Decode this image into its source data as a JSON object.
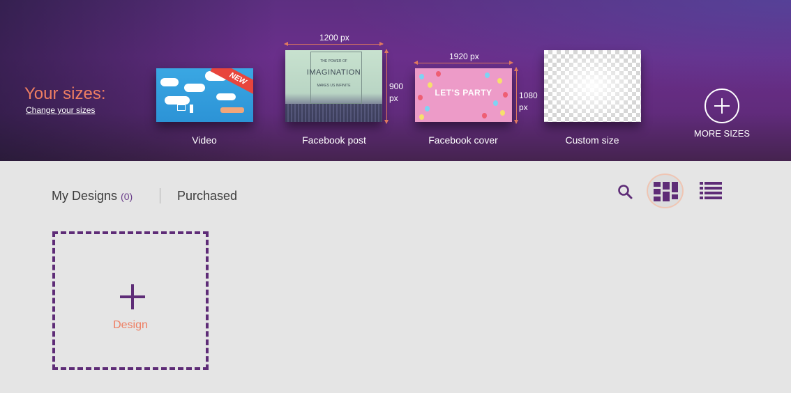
{
  "sizes_panel": {
    "heading": "Your sizes:",
    "change_link": "Change your sizes",
    "cards": [
      {
        "label": "Video",
        "thumb_badge": "NEW"
      },
      {
        "label": "Facebook post",
        "width_text": "1200 px",
        "height_text": "900",
        "height_unit": "px",
        "thumb_line1": "THE POWER OF",
        "thumb_title": "IMAGINATION",
        "thumb_line3": "MAKES US INFINITE"
      },
      {
        "label": "Facebook cover",
        "width_text": "1920 px",
        "height_text": "1080",
        "height_unit": "px",
        "thumb_title": "LET'S PARTY"
      },
      {
        "label": "Custom size"
      }
    ],
    "more_label": "MORE SIZES"
  },
  "tabs": {
    "my_designs_label": "My Designs",
    "my_designs_count": "(0)",
    "purchased_label": "Purchased"
  },
  "toolbar": {
    "search_icon": "search-icon",
    "grid_icon": "grid-view-icon",
    "list_icon": "list-view-icon"
  },
  "design_tile": {
    "label": "Design"
  },
  "colors": {
    "purple": "#5e2c77",
    "accent": "#ee7e62"
  }
}
